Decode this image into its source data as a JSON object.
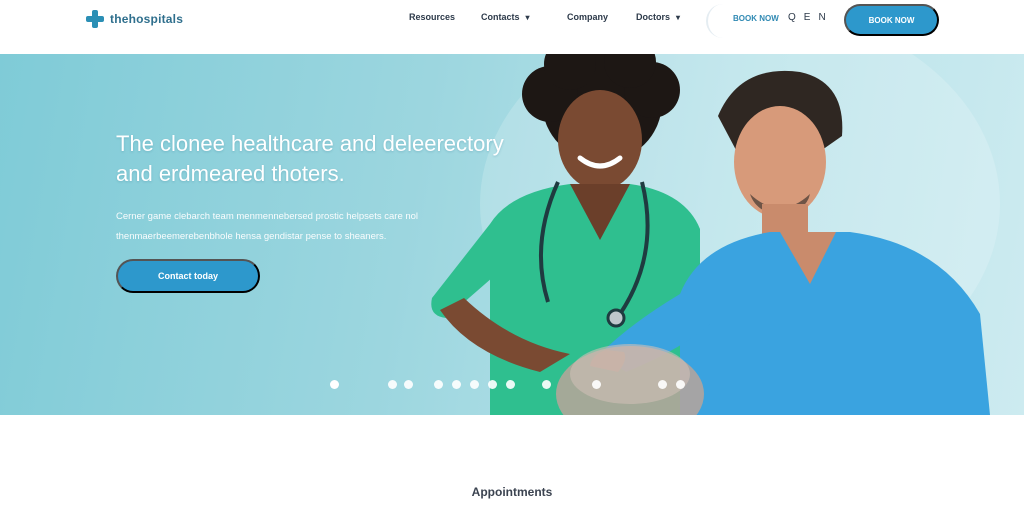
{
  "header": {
    "logo_text": "thehospitals",
    "nav": [
      {
        "label": "Resources",
        "has_caret": false
      },
      {
        "label": "Contacts",
        "has_caret": true
      },
      {
        "label": "Company",
        "has_caret": false
      },
      {
        "label": "Doctors",
        "has_caret": true
      }
    ],
    "phone_link": "BOOK NOW",
    "lang_items": [
      "Q",
      "E",
      "N"
    ],
    "cta_label": "BOOK NOW"
  },
  "hero": {
    "title": "The clonee healthcare and deleerectory and erdmeared thoters.",
    "subtitle": "Cerner game clebarch team menmennebersed prostic helpsets care nol thenmaerbeemerebenbhole hensa gendistar pense to sheaners.",
    "cta_label": "Contact today",
    "slide_count": 12,
    "active_slide": 0
  },
  "section": {
    "title": "Appointments"
  },
  "colors": {
    "brand": "#2d98cc",
    "logo": "#2b8fb5",
    "hero_bg": "#9cd6df",
    "scrub_green": "#2fbf8f",
    "scrub_blue": "#3aa3e0"
  }
}
